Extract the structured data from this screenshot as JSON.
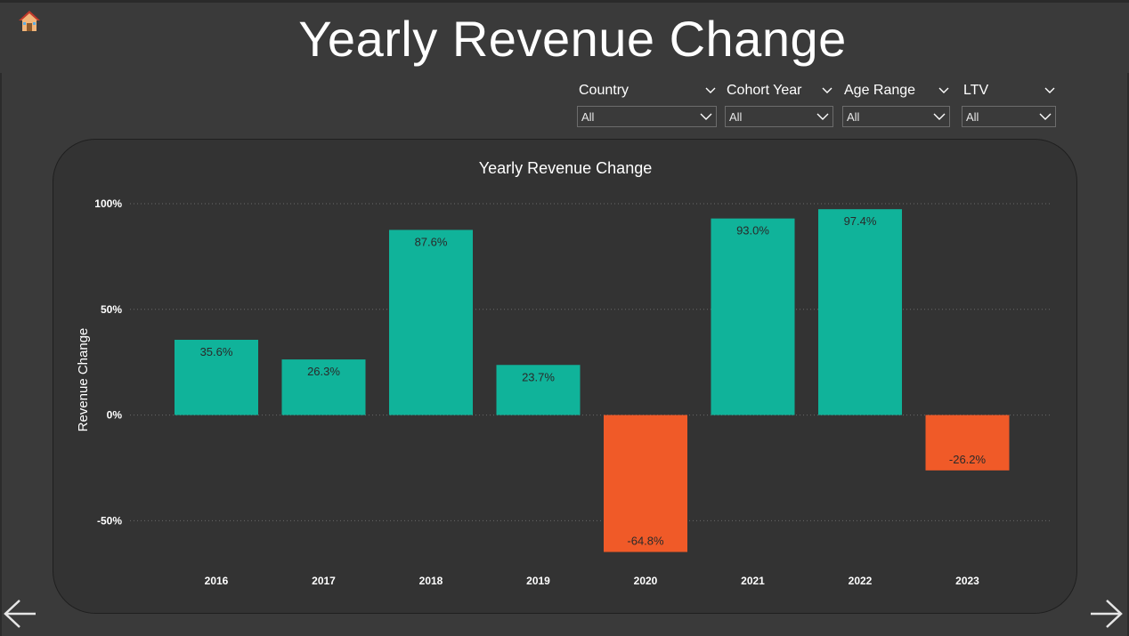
{
  "page": {
    "title": "Yearly Revenue Change",
    "home_icon": "home-icon",
    "nav": {
      "prev_icon": "arrow-left-icon",
      "next_icon": "arrow-right-icon"
    }
  },
  "filters": [
    {
      "label": "Country",
      "value": "All"
    },
    {
      "label": "Cohort Year",
      "value": "All"
    },
    {
      "label": "Age Range",
      "value": "All"
    },
    {
      "label": "LTV",
      "value": "All"
    }
  ],
  "colors": {
    "positive": "#10b39a",
    "negative": "#f05a28",
    "card": "#333333",
    "background": "#3a3a3a"
  },
  "chart_data": {
    "type": "bar",
    "title": "Yearly Revenue Change",
    "xlabel": "",
    "ylabel": "Revenue Change",
    "categories": [
      "2016",
      "2017",
      "2018",
      "2019",
      "2020",
      "2021",
      "2022",
      "2023"
    ],
    "values": [
      35.6,
      26.3,
      87.6,
      23.7,
      -64.8,
      93.0,
      97.4,
      -26.2
    ],
    "data_labels": [
      "35.6%",
      "26.3%",
      "87.6%",
      "23.7%",
      "-64.8%",
      "93.0%",
      "97.4%",
      "-26.2%"
    ],
    "ylim": [
      -65,
      100
    ],
    "yticks": [
      100,
      50,
      0,
      -50
    ],
    "ytick_labels": [
      "100%",
      "50%",
      "0%",
      "-50%"
    ],
    "grid": true,
    "legend": "none"
  }
}
